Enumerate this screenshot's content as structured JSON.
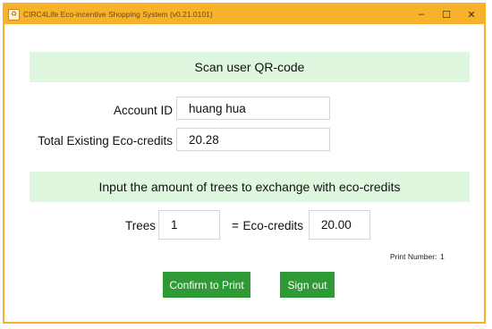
{
  "window": {
    "title": "CIRC4Life Eco-incentive Shopping System (v0.21.0101)",
    "accent_color": "#f5b22a",
    "controls": {
      "minimize": "–",
      "maximize": "☐",
      "close": "✕"
    }
  },
  "scan_section": {
    "heading": "Scan user QR-code"
  },
  "account": {
    "account_id_label": "Account ID",
    "account_id_value": "huang hua",
    "credits_label": "Total Existing Eco-credits",
    "credits_value": "20.28"
  },
  "exchange_section": {
    "heading": "Input the amount of trees to exchange with eco-credits"
  },
  "exchange": {
    "trees_label": "Trees",
    "trees_value": "1",
    "equals": "=",
    "eco_credits_label": "Eco-credits",
    "eco_credits_value": "20.00"
  },
  "print": {
    "label": "Print Number:",
    "number": "1"
  },
  "buttons": {
    "confirm_label": "Confirm to Print",
    "signout_label": "Sign out",
    "color": "#2f9a35"
  }
}
